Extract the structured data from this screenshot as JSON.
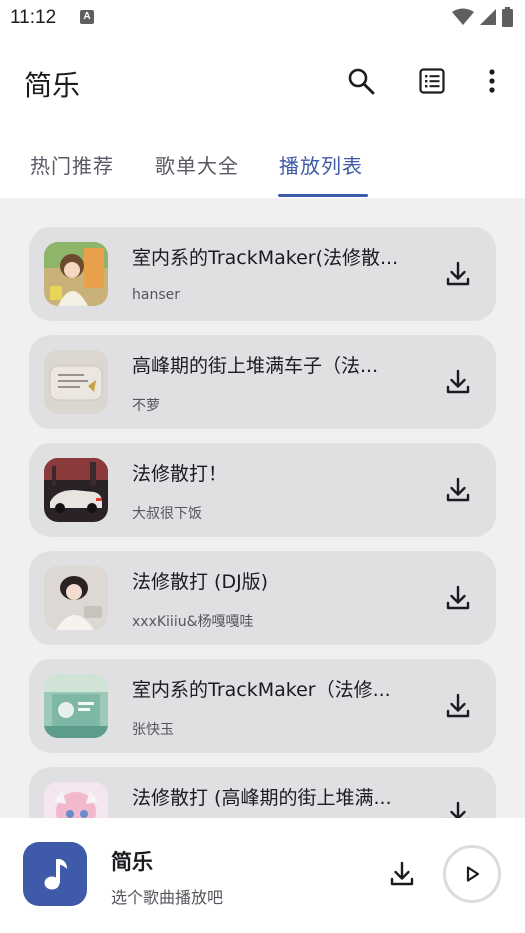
{
  "status": {
    "time": "11:12",
    "notification_glyph": "A"
  },
  "app": {
    "title": "简乐"
  },
  "toolbar": {
    "icons": [
      "search-icon",
      "list-icon",
      "more-vert-icon"
    ]
  },
  "tabs": [
    {
      "label": "热门推荐",
      "active": false
    },
    {
      "label": "歌单大全",
      "active": false
    },
    {
      "label": "播放列表",
      "active": true
    }
  ],
  "songs": [
    {
      "title": "室内系的TrackMaker(法修散...",
      "artist": "hanser"
    },
    {
      "title": "高峰期的街上堆满车子（法...",
      "artist": "不萝"
    },
    {
      "title": "法修散打！",
      "artist": "大叔很下饭"
    },
    {
      "title": "法修散打 (DJ版)",
      "artist": "xxxKiiiu&杨嘎嘎哇"
    },
    {
      "title": "室内系的TrackMaker（法修...",
      "artist": "张快玉"
    },
    {
      "title": "法修散打 (高峰期的街上堆满...",
      "artist": ""
    }
  ],
  "player": {
    "title": "简乐",
    "subtitle": "选个歌曲播放吧"
  },
  "colors": {
    "accent": "#3f5aa8",
    "card": "#e0e0e2",
    "background": "#f0f0f1"
  }
}
